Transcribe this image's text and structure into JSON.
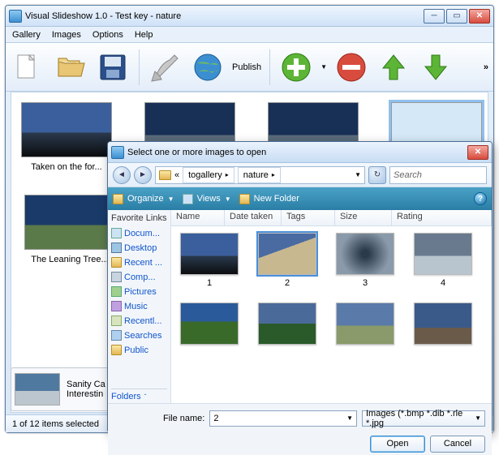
{
  "window": {
    "title": "Visual Slideshow 1.0 - Test key - nature",
    "menu": [
      "Gallery",
      "Images",
      "Options",
      "Help"
    ],
    "publish": "Publish",
    "thumbs": [
      "Taken on the for...",
      "",
      "",
      ""
    ],
    "leaning": "The Leaning Tree...",
    "sanity1": "Sanity Ca",
    "sanity2": "Interestin",
    "status": "1 of 12 items selected"
  },
  "dialog": {
    "title": "Select one or more images to open",
    "crumb1": "togallery",
    "crumb2": "nature",
    "search": "Search",
    "organize": "Organize",
    "views": "Views",
    "newfolder": "New Folder",
    "favhead": "Favorite Links",
    "fav": [
      "Docum...",
      "Desktop",
      "Recent ...",
      "Comp...",
      "Pictures",
      "Music",
      "Recentl...",
      "Searches",
      "Public"
    ],
    "folders": "Folders",
    "cols": {
      "name": "Name",
      "date": "Date taken",
      "tags": "Tags",
      "size": "Size",
      "rating": "Rating"
    },
    "thumbs": [
      "1",
      "2",
      "3",
      "4"
    ],
    "filelabel": "File name:",
    "filename": "2",
    "filter": "Images (*.bmp *.dib *.rle *.jpg",
    "open": "Open",
    "cancel": "Cancel"
  }
}
